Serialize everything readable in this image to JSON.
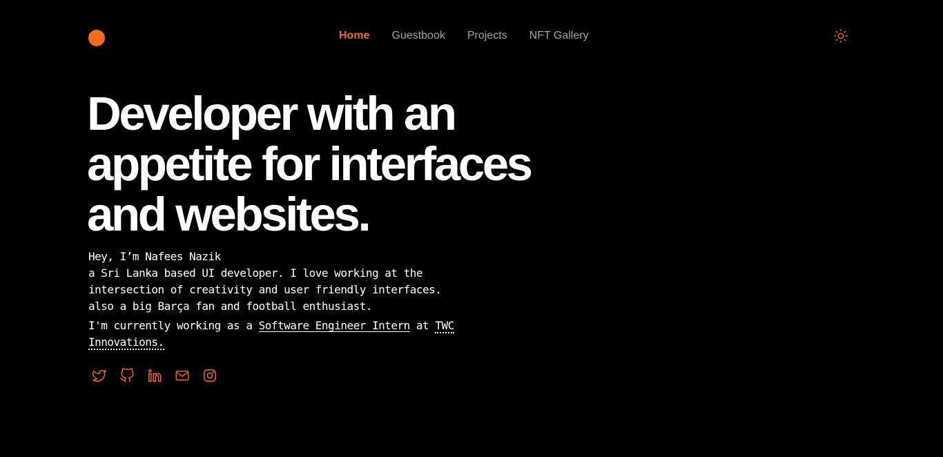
{
  "brand": {
    "accent": "#f26b21",
    "background": "#000000",
    "nav_inactive": "#a3a3a3"
  },
  "nav": {
    "items": [
      {
        "label": "Home",
        "active": true
      },
      {
        "label": "Guestbook",
        "active": false
      },
      {
        "label": "Projects",
        "active": false
      },
      {
        "label": "NFT Gallery",
        "active": false
      }
    ]
  },
  "theme_toggle": {
    "icon": "sun-icon"
  },
  "hero": {
    "title_lines": [
      "Developer with an",
      "appetite for interfaces",
      "and websites."
    ]
  },
  "intro": {
    "greeting": "Hey, I’m Nafees Nazik",
    "bio_lines": [
      "a Sri Lanka based UI developer. I love working at the",
      "intersection of creativity and user friendly interfaces.",
      "also a big Barça fan and football enthusiast."
    ],
    "work_prefix": "I'm currently working as a ",
    "role": "Software Engineer Intern",
    "work_middle": " at ",
    "company": "TWC Innovations."
  },
  "socials": [
    {
      "name": "twitter",
      "icon": "twitter-icon"
    },
    {
      "name": "github",
      "icon": "github-icon"
    },
    {
      "name": "linkedin",
      "icon": "linkedin-icon"
    },
    {
      "name": "email",
      "icon": "mail-icon"
    },
    {
      "name": "instagram",
      "icon": "instagram-icon"
    }
  ]
}
